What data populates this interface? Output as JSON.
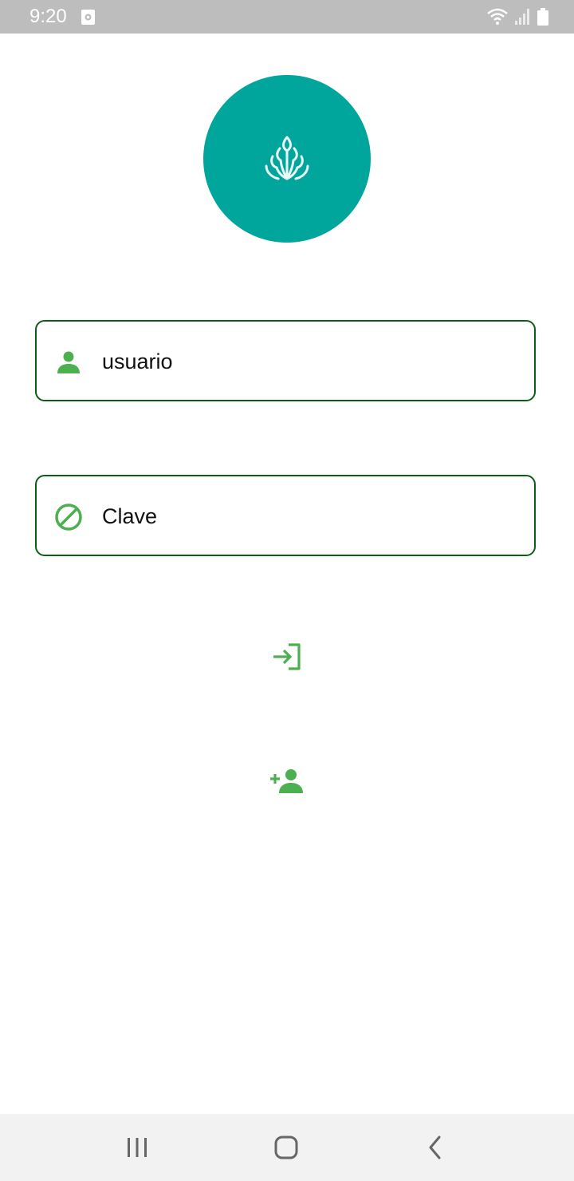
{
  "status_bar": {
    "time": "9:20"
  },
  "logo": {
    "icon": "leaf-sprout-logo",
    "background_color": "#00a69c"
  },
  "form": {
    "username": {
      "placeholder": "usuario",
      "icon": "person-icon"
    },
    "password": {
      "placeholder": "Clave",
      "icon": "block-icon"
    },
    "border_color": "#0b5e16",
    "icon_color": "#4caf50"
  },
  "actions": {
    "login_icon": "login-icon",
    "register_icon": "person-add-icon"
  },
  "nav_bar": {
    "recents_icon": "recents-icon",
    "home_icon": "home-icon",
    "back_icon": "back-icon"
  }
}
